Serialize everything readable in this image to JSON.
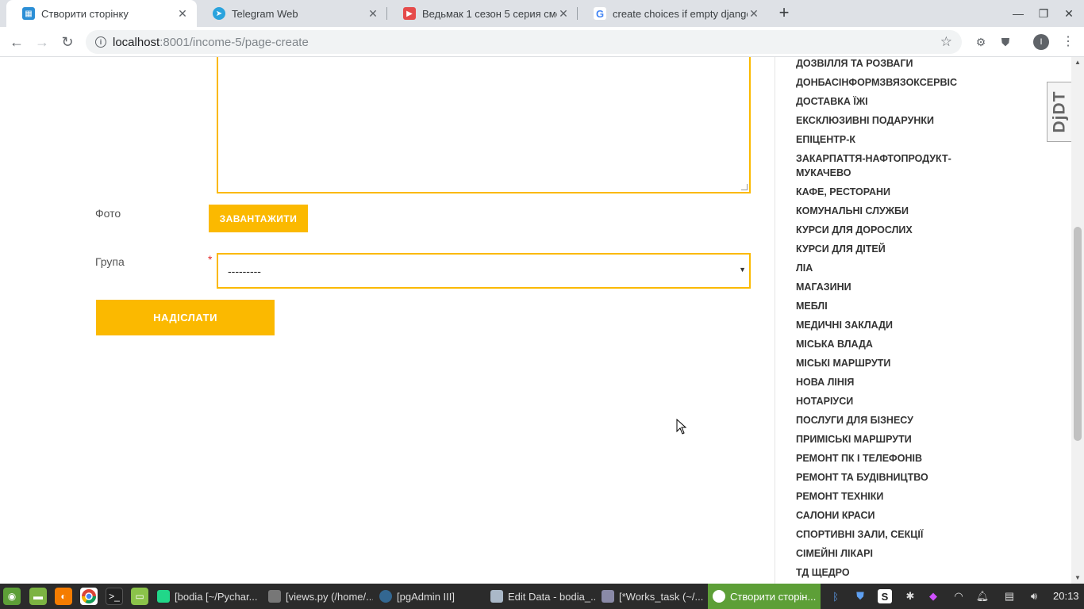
{
  "browser": {
    "tabs": [
      {
        "title": "Створити сторінку",
        "active": true
      },
      {
        "title": "Telegram Web",
        "active": false
      },
      {
        "title": "Ведьмак 1 сезон 5 серия смотр",
        "active": false
      },
      {
        "title": "create choices if empty django",
        "active": false
      }
    ],
    "new_tab": "+",
    "url_host": "localhost",
    "url_rest": ":8001/income-5/page-create",
    "avatar_letter": "I"
  },
  "form": {
    "photo_label": "Фото",
    "upload_label": "ЗАВАНТАЖИТИ",
    "group_label": "Група",
    "required_mark": "*",
    "group_value": "---------",
    "submit_label": "НАДІСЛАТИ"
  },
  "sidebar": {
    "categories": [
      "ДОЗВІЛЛЯ ТА РОЗВАГИ",
      "ДОНБАСІНФОРМЗВЯЗОКСЕРВІС",
      "ДОСТАВКА ЇЖІ",
      "ЕКСКЛЮЗИВНІ ПОДАРУНКИ",
      "ЕПІЦЕНТР-К",
      "ЗАКАРПАТТЯ-НАФТОПРОДУКТ-МУКАЧЕВО",
      "КАФЕ, РЕСТОРАНИ",
      "КОМУНАЛЬНІ СЛУЖБИ",
      "КУРСИ ДЛЯ ДОРОСЛИХ",
      "КУРСИ ДЛЯ ДІТЕЙ",
      "ЛІА",
      "МАГАЗИНИ",
      "МЕБЛІ",
      "МЕДИЧНІ ЗАКЛАДИ",
      "МІСЬКА ВЛАДА",
      "МІСЬКІ МАРШРУТИ",
      "НОВА ЛІНІЯ",
      "НОТАРІУСИ",
      "ПОСЛУГИ ДЛЯ БІЗНЕСУ",
      "ПРИМІСЬКІ МАРШРУТИ",
      "РЕМОНТ ПК І ТЕЛЕФОНІВ",
      "РЕМОНТ ТА БУДІВНИЦТВО",
      "РЕМОНТ ТЕХНІКИ",
      "САЛОНИ КРАСИ",
      "СПОРТИВНІ ЗАЛИ, СЕКЦІЇ",
      "СІМЕЙНІ ЛІКАРІ",
      "ТД ЩЕДРО"
    ]
  },
  "djdt_label": "DjDT",
  "taskbar": {
    "items": [
      {
        "title": "[bodia [~/Pychar...",
        "active": false
      },
      {
        "title": "[views.py (/home/...",
        "active": false
      },
      {
        "title": "[pgAdmin III]",
        "active": false
      },
      {
        "title": "Edit Data - bodia_...",
        "active": false
      },
      {
        "title": "[*Works_task (~/...",
        "active": false
      },
      {
        "title": "Створити сторін...",
        "active": true
      }
    ],
    "clock": "20:13"
  },
  "colors": {
    "accent": "#fbb900",
    "required": "#e52d2d",
    "taskbar_active": "#5d9f37"
  }
}
